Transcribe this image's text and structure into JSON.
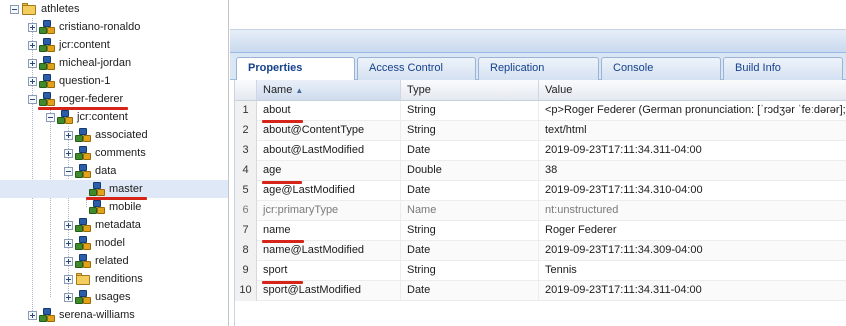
{
  "tree": {
    "root": {
      "label": "athletes",
      "icon": "folder-icon"
    },
    "items": [
      {
        "label": "cristiano-ronaldo",
        "icon": "node-icon",
        "expander": "plus"
      },
      {
        "label": "jcr:content",
        "icon": "node-icon",
        "expander": "plus"
      },
      {
        "label": "micheal-jordan",
        "icon": "node-icon",
        "expander": "plus"
      },
      {
        "label": "question-1",
        "icon": "node-icon",
        "expander": "plus"
      },
      {
        "label": "roger-federer",
        "icon": "node-icon",
        "expander": "minus"
      },
      {
        "label": "jcr:content",
        "icon": "node-icon",
        "expander": "minus"
      },
      {
        "label": "associated",
        "icon": "node-icon",
        "expander": "plus"
      },
      {
        "label": "comments",
        "icon": "node-icon",
        "expander": "plus"
      },
      {
        "label": "data",
        "icon": "node-icon",
        "expander": "minus"
      },
      {
        "label": "master",
        "icon": "node-icon",
        "expander": "none",
        "selected": true
      },
      {
        "label": "mobile",
        "icon": "node-icon",
        "expander": "none"
      },
      {
        "label": "metadata",
        "icon": "node-icon",
        "expander": "plus"
      },
      {
        "label": "model",
        "icon": "node-icon",
        "expander": "plus"
      },
      {
        "label": "related",
        "icon": "node-icon",
        "expander": "plus"
      },
      {
        "label": "renditions",
        "icon": "folder-icon",
        "expander": "plus"
      },
      {
        "label": "usages",
        "icon": "node-icon",
        "expander": "plus"
      },
      {
        "label": "serena-williams",
        "icon": "node-icon",
        "expander": "plus"
      }
    ]
  },
  "tabs": [
    {
      "label": "Properties",
      "active": true
    },
    {
      "label": "Access Control",
      "active": false
    },
    {
      "label": "Replication",
      "active": false
    },
    {
      "label": "Console",
      "active": false
    },
    {
      "label": "Build Info",
      "active": false
    }
  ],
  "grid": {
    "columns": {
      "name": "Name",
      "type": "Type",
      "value": "Value"
    },
    "sort": {
      "column": "name",
      "direction": "ascending"
    },
    "rows": [
      {
        "num": "1",
        "name": "about",
        "type": "String",
        "value": "<p>Roger Federer (German pronunciation: [ˈrɔdʒər ˈfeːdərər];"
      },
      {
        "num": "2",
        "name": "about@ContentType",
        "type": "String",
        "value": "text/html"
      },
      {
        "num": "3",
        "name": "about@LastModified",
        "type": "Date",
        "value": "2019-09-23T17:11:34.311-04:00"
      },
      {
        "num": "4",
        "name": "age",
        "type": "Double",
        "value": "38"
      },
      {
        "num": "5",
        "name": "age@LastModified",
        "type": "Date",
        "value": "2019-09-23T17:11:34.310-04:00"
      },
      {
        "num": "6",
        "name": "jcr:primaryType",
        "type": "Name",
        "value": "nt:unstructured",
        "protected": true
      },
      {
        "num": "7",
        "name": "name",
        "type": "String",
        "value": "Roger Federer"
      },
      {
        "num": "8",
        "name": "name@LastModified",
        "type": "Date",
        "value": "2019-09-23T17:11:34.309-04:00"
      },
      {
        "num": "9",
        "name": "sport",
        "type": "String",
        "value": "Tennis"
      },
      {
        "num": "10",
        "name": "sport@LastModified",
        "type": "Date",
        "value": "2019-09-23T17:11:34.311-04:00"
      }
    ]
  },
  "annotations": {
    "underlined_tree_items": [
      "roger-federer",
      "master"
    ],
    "underlined_properties": [
      "about",
      "age",
      "name",
      "sport"
    ],
    "color": "#d62418"
  },
  "colors": {
    "selection": "#dfe8f6",
    "tab_text": "#15428b",
    "panel_border": "#99bbe8"
  }
}
